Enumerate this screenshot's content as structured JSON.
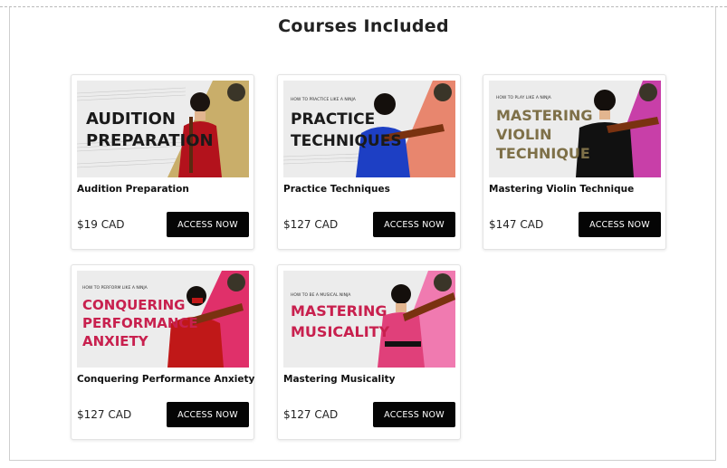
{
  "page": {
    "title": "Courses Included"
  },
  "courses": [
    {
      "name": "Audition Preparation",
      "price": "$19 CAD",
      "button_label": "ACCESS NOW",
      "thumbnail": {
        "kicker": "",
        "headline_lines": [
          "AUDITION",
          "PREPARATION"
        ],
        "headline_color": "#1a1a1a",
        "accent_color": "#c9ae6a",
        "dress_color": "#b3121c"
      }
    },
    {
      "name": "Practice Techniques",
      "price": "$127 CAD",
      "button_label": "ACCESS NOW",
      "thumbnail": {
        "kicker": "HOW TO PRACTICE LIKE A NINJA",
        "headline_lines": [
          "PRACTICE",
          "TECHNIQUES"
        ],
        "headline_color": "#1a1a1a",
        "accent_color": "#e8866e",
        "dress_color": "#1d3fc4"
      }
    },
    {
      "name": "Mastering Violin Technique",
      "price": "$147 CAD",
      "button_label": "ACCESS NOW",
      "thumbnail": {
        "kicker": "HOW TO PLAY LIKE A NINJA",
        "headline_lines": [
          "MASTERING",
          "VIOLIN",
          "TECHNIQUE"
        ],
        "headline_color": "#7e7048",
        "accent_color": "#c83fa8",
        "dress_color": "#111111"
      }
    },
    {
      "name": "Conquering Performance Anxiety",
      "price": "$127 CAD",
      "button_label": "ACCESS NOW",
      "thumbnail": {
        "kicker": "HOW TO PERFORM LIKE A NINJA",
        "headline_lines": [
          "CONQUERING",
          "PERFORMANCE",
          "ANXIETY"
        ],
        "headline_color": "#c8204e",
        "accent_color": "#e0306a",
        "dress_color": "#c01818"
      }
    },
    {
      "name": "Mastering Musicality",
      "price": "$127 CAD",
      "button_label": "ACCESS NOW",
      "thumbnail": {
        "kicker": "HOW TO BE A MUSICAL NINJA",
        "headline_lines": [
          "MASTERING",
          "MUSICALITY"
        ],
        "headline_color": "#c8204e",
        "accent_color": "#f07ab0",
        "dress_color": "#e0407a"
      }
    }
  ]
}
